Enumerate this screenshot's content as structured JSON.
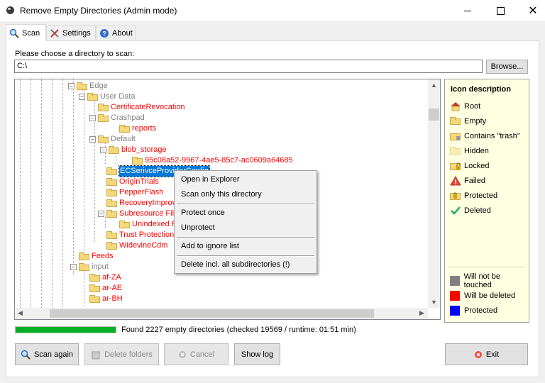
{
  "window": {
    "title": "Remove Empty Directories (Admin mode)"
  },
  "tabs": [
    {
      "label": "Scan",
      "icon": "magnifier-icon"
    },
    {
      "label": "Settings",
      "icon": "tools-icon"
    },
    {
      "label": "About",
      "icon": "help-icon"
    }
  ],
  "scan": {
    "directory_label": "Please choose a directory to scan:",
    "directory_value": "C:\\",
    "browse_label": "Browse..."
  },
  "tree": {
    "rows": [
      {
        "label": "Edge",
        "color": "gray"
      },
      {
        "label": "User Data",
        "color": "gray"
      },
      {
        "label": "CertificateRevocation",
        "color": "red"
      },
      {
        "label": "Crashpad",
        "color": "gray"
      },
      {
        "label": "reports",
        "color": "red"
      },
      {
        "label": "Default",
        "color": "gray"
      },
      {
        "label": "blob_storage",
        "color": "red"
      },
      {
        "label": "95c08a52-9967-4ae5-85c7-ac0609a64685",
        "color": "red"
      },
      {
        "label": "ECSerivceProviderConfig",
        "color": "selected"
      },
      {
        "label": "OriginTrials",
        "color": "red"
      },
      {
        "label": "PepperFlash",
        "color": "red"
      },
      {
        "label": "RecoveryImprove",
        "color": "red"
      },
      {
        "label": "Subresource Filte",
        "color": "red"
      },
      {
        "label": "Unindexed R",
        "color": "red"
      },
      {
        "label": "Trust Protection L",
        "color": "red"
      },
      {
        "label": "WidevineCdm",
        "color": "red"
      },
      {
        "label": "Feeds",
        "color": "red"
      },
      {
        "label": "input",
        "color": "gray"
      },
      {
        "label": "af-ZA",
        "color": "red"
      },
      {
        "label": "ar-AE",
        "color": "red"
      },
      {
        "label": "ar-BH",
        "color": "red"
      }
    ]
  },
  "context_menu": {
    "items": [
      "Open in Explorer",
      "Scan only this directory",
      "Protect once",
      "Unprotect",
      "Add to ignore list",
      "Delete incl. all subdirectories (!)"
    ]
  },
  "legend": {
    "title": "Icon description",
    "items": [
      {
        "label": "Root",
        "icon": "root-folder-icon"
      },
      {
        "label": "Empty",
        "icon": "empty-folder-icon"
      },
      {
        "label": "Contains \"trash\"",
        "icon": "trash-folder-icon"
      },
      {
        "label": "Hidden",
        "icon": "hidden-folder-icon"
      },
      {
        "label": "Locked",
        "icon": "locked-folder-icon"
      },
      {
        "label": "Failed",
        "icon": "warning-icon"
      },
      {
        "label": "Protected",
        "icon": "protected-folder-icon"
      },
      {
        "label": "Deleted",
        "icon": "checkmark-icon"
      }
    ],
    "colors": [
      {
        "label": "Will not be touched",
        "color": "#808080"
      },
      {
        "label": "Will be deleted",
        "color": "#ff0000"
      },
      {
        "label": "Protected",
        "color": "#0000ff"
      }
    ]
  },
  "status": {
    "progress_percent": 100,
    "progress_color": "#06b025",
    "text": "Found 2227 empty directories (checked 19569 / runtime: 01:51 min)"
  },
  "buttons": {
    "scan_again": "Scan again",
    "delete_folders": "Delete folders",
    "cancel": "Cancel",
    "show_log": "Show log",
    "exit": "Exit"
  }
}
